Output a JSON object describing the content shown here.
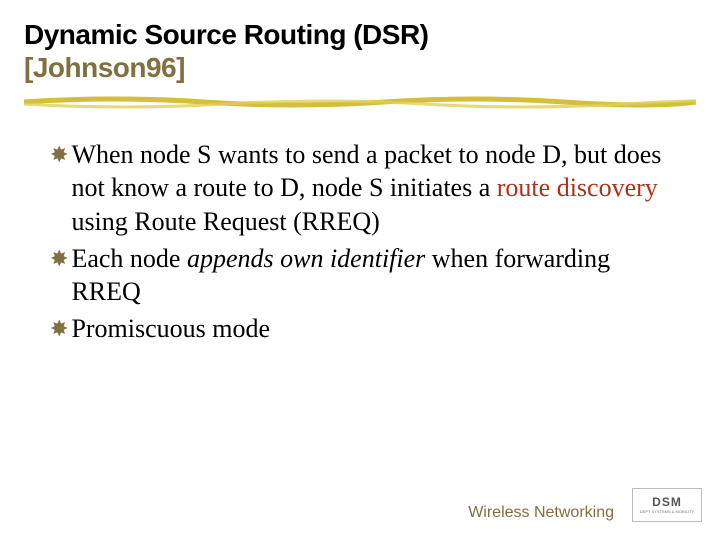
{
  "title": {
    "line1": "Dynamic Source Routing (DSR)",
    "citation": "[Johnson96]"
  },
  "bullets": [
    {
      "parts": [
        {
          "t": "plain",
          "v": "When node S wants to send a packet to node D, but does not know a route to D, node S initiates a "
        },
        {
          "t": "term",
          "v": "route discovery"
        },
        {
          "t": "plain",
          "v": " using Route Request (RREQ)"
        }
      ]
    },
    {
      "parts": [
        {
          "t": "plain",
          "v": "Each node "
        },
        {
          "t": "em",
          "v": "appends own identifier"
        },
        {
          "t": "plain",
          "v": " when forwarding RREQ"
        }
      ]
    },
    {
      "parts": [
        {
          "t": "plain",
          "v": "Promiscuous mode"
        }
      ]
    }
  ],
  "footer": {
    "label": "Wireless Networking",
    "logo_abbrev": "DSM",
    "logo_sub": "DEPT SYSTEMS & MOBILITY"
  },
  "glyph": "✸",
  "colors": {
    "accent": "#807040",
    "term": "#b03018"
  }
}
